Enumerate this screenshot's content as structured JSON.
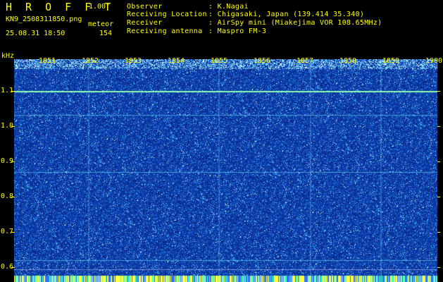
{
  "header": {
    "app_title": "H R O F F T",
    "version": "1.00f",
    "filename": "KN9_2508311850.png",
    "meteor_label": "meteor",
    "datetime": "25.08.31 18:50",
    "meteor_count": "154",
    "info": [
      {
        "key": "Observer",
        "value": ": K.Nagai"
      },
      {
        "key": "Receiving Location",
        "value": ": Chigasaki, Japan (139.414 35.340)"
      },
      {
        "key": "Receiver",
        "value": ": AirSpy mini (Miakejima VOR 108.65MHz)"
      },
      {
        "key": "Receiving antenna",
        "value": ": Maspro FM-3"
      }
    ]
  },
  "axis": {
    "y_unit": "kHz",
    "y_ticks": [
      "1.1",
      "1.0",
      "0.9",
      "0.8",
      "0.7",
      "0.6"
    ],
    "x_ticks": [
      "1851",
      "1852",
      "1853",
      "1854",
      "1855",
      "1856",
      "1857",
      "1858",
      "1859",
      "1900"
    ]
  },
  "colors": {
    "background": "#000000",
    "label": "#ffff00",
    "spectrogram_base": "#0c3aa8",
    "noise_light": "#52c8ff",
    "signal_line": "#8fffb0"
  }
}
